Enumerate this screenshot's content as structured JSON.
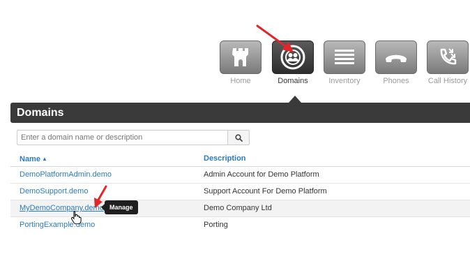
{
  "nav": {
    "items": [
      {
        "label": "Home",
        "icon": "castle-icon"
      },
      {
        "label": "Domains",
        "icon": "users-circle-icon",
        "active": true
      },
      {
        "label": "Inventory",
        "icon": "list-icon"
      },
      {
        "label": "Phones",
        "icon": "phone-handset-icon"
      },
      {
        "label": "Call History",
        "icon": "call-history-icon"
      }
    ]
  },
  "section": {
    "title": "Domains"
  },
  "search": {
    "placeholder": "Enter a domain name or description",
    "value": ""
  },
  "table": {
    "columns": {
      "name": "Name",
      "description": "Description"
    },
    "rows": [
      {
        "name": "DemoPlatformAdmin.demo",
        "description": "Admin Account for Demo Platform"
      },
      {
        "name": "DemoSupport.demo",
        "description": "Support Account For Demo Platform"
      },
      {
        "name": "MyDemoCompany.demo",
        "description": "Demo Company Ltd"
      },
      {
        "name": "PortingExample.demo",
        "description": "Porting"
      }
    ]
  },
  "tooltip": {
    "text": "Manage"
  },
  "colors": {
    "accent": "#2a7bbf",
    "header_bar": "#3a3a3a",
    "annotation_arrow": "#e0262b"
  }
}
